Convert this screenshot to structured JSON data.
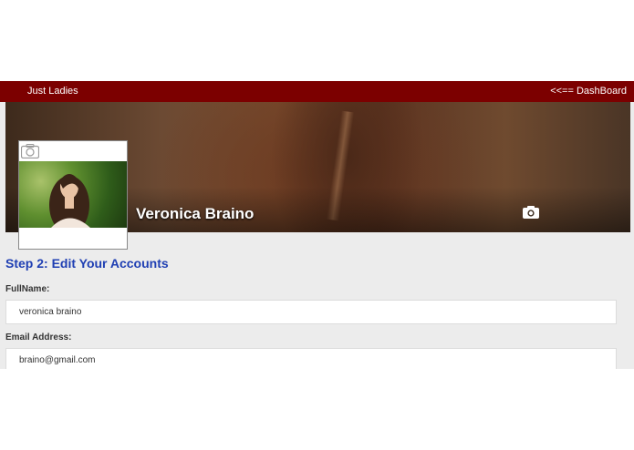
{
  "navbar": {
    "brand": "Just Ladies",
    "dashboard_link": "<<== DashBoard",
    "color": "#7c0000"
  },
  "profile": {
    "name": "Veronica Braino",
    "cover_icon": "camera-icon",
    "avatar_icon": "camera-icon"
  },
  "form": {
    "step_title": "Step 2: Edit Your Accounts",
    "title_color": "#1f3fb3",
    "fullname": {
      "label": "FullName:",
      "value": "veronica braino"
    },
    "email": {
      "label": "Email Address:",
      "value": "braino@gmail.com"
    }
  }
}
